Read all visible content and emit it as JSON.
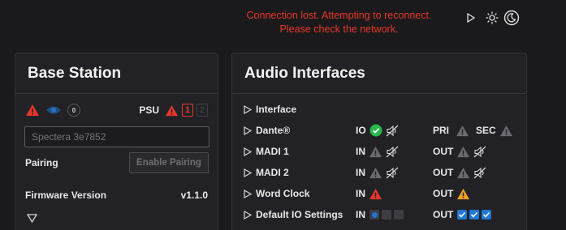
{
  "banner": {
    "line1": "Connection lost. Attempting to reconnect.",
    "line2": "Please check the network."
  },
  "topbar": {
    "icons": [
      "play-icon",
      "brightness-icon",
      "dark-mode-icon"
    ]
  },
  "base_station": {
    "title": "Base Station",
    "status_icons": [
      "warning-icon",
      "visibility-icon",
      "zero-badge-icon"
    ],
    "zero_badge": "0",
    "psu_label": "PSU",
    "psu_one": "1",
    "psu_two": "2",
    "name_placeholder": "Spectera 3e7852",
    "pairing_label": "Pairing",
    "pairing_button": "Enable Pairing",
    "firmware_label": "Firmware Version",
    "firmware_value": "v1.1.0"
  },
  "audio_interfaces": {
    "title": "Audio Interfaces",
    "header_label": "Interface",
    "rows": [
      {
        "name": "Dante®",
        "mid_label": "IO",
        "right_label": "PRI",
        "right2_label": "SEC"
      },
      {
        "name": "MADI 1",
        "mid_label": "IN",
        "right_label": "OUT"
      },
      {
        "name": "MADI 2",
        "mid_label": "IN",
        "right_label": "OUT"
      },
      {
        "name": "Word Clock",
        "mid_label": "IN",
        "right_label": "OUT"
      },
      {
        "name": "Default IO Settings",
        "mid_label": "IN",
        "right_label": "OUT"
      }
    ]
  },
  "colors": {
    "error": "#e8362a",
    "warning": "#f0a020",
    "ok": "#27b84a",
    "accent": "#1e78d4",
    "background": "#1a1a1c",
    "panel": "#222226"
  }
}
